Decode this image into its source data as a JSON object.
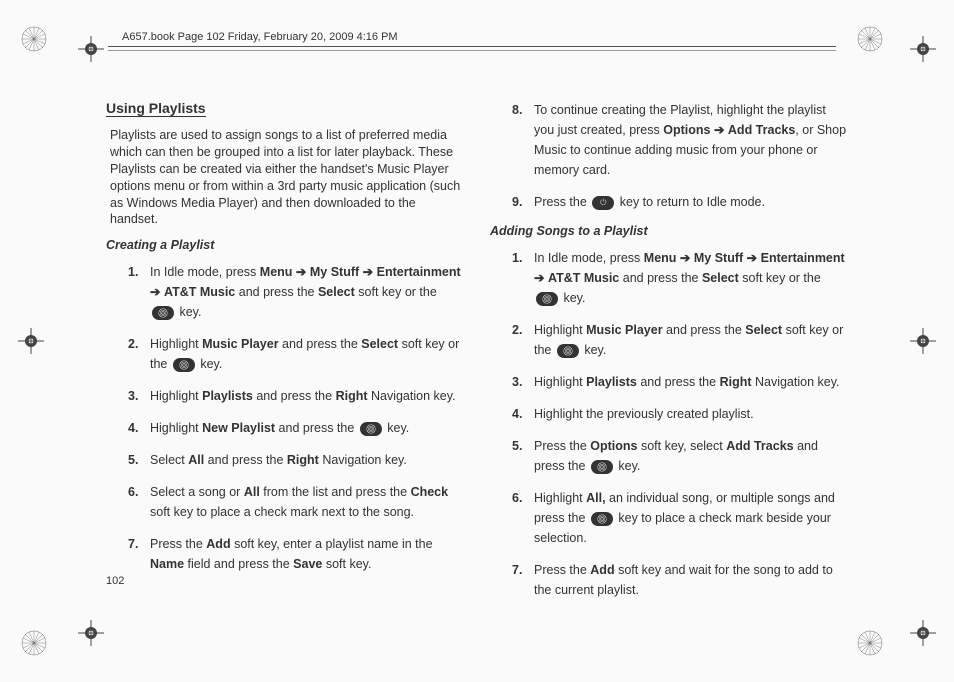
{
  "header": {
    "doc_info": "A657.book  Page 102  Friday, February 20, 2009  4:16 PM"
  },
  "page_number": "102",
  "section": {
    "title": "Using Playlists",
    "intro": "Playlists are used to assign songs to a list of preferred media which can then be grouped into a list for later playback. These Playlists can be created via either the handset's Music Player options menu or from within a 3rd party music application (such as Windows Media Player) and then downloaded to the handset."
  },
  "sub1": {
    "title": "Creating a Playlist",
    "steps": [
      {
        "n": "1.",
        "parts": [
          "In Idle mode, press ",
          {
            "b": "Menu"
          },
          " ",
          {
            "arrow": true
          },
          " ",
          {
            "b": "My Stuff"
          },
          " ",
          {
            "arrow": true
          },
          " ",
          {
            "b": "Entertainment"
          },
          " ",
          {
            "arrow": true
          },
          " ",
          {
            "b": "AT&T Music"
          },
          " and press the ",
          {
            "b": "Select"
          },
          " soft key or the ",
          {
            "icon": "circle"
          },
          " key."
        ]
      },
      {
        "n": "2.",
        "parts": [
          "Highlight ",
          {
            "b": "Music Player"
          },
          " and press the ",
          {
            "b": "Select"
          },
          " soft key or the ",
          {
            "icon": "circle"
          },
          " key."
        ]
      },
      {
        "n": "3.",
        "parts": [
          "Highlight ",
          {
            "b": "Playlists"
          },
          " and press the ",
          {
            "b": "Right"
          },
          " Navigation key."
        ]
      },
      {
        "n": "4.",
        "parts": [
          "Highlight ",
          {
            "b": "New Playlist"
          },
          " and press the ",
          {
            "icon": "circle"
          },
          " key."
        ]
      },
      {
        "n": "5.",
        "parts": [
          "Select ",
          {
            "b": "All"
          },
          " and press the ",
          {
            "b": "Right"
          },
          " Navigation key."
        ]
      },
      {
        "n": "6.",
        "parts": [
          "Select a song or ",
          {
            "b": "All"
          },
          " from the list and press the ",
          {
            "b": "Check"
          },
          " soft key to place a check mark next to the song."
        ]
      },
      {
        "n": "7.",
        "parts": [
          "Press the ",
          {
            "b": "Add"
          },
          " soft key, enter a playlist name in the ",
          {
            "b": "Name"
          },
          " field and press the ",
          {
            "b": "Save"
          },
          " soft key."
        ]
      },
      {
        "n": "8.",
        "parts": [
          "To continue creating the Playlist, highlight the playlist you just created, press ",
          {
            "b": "Options"
          },
          " ",
          {
            "arrow": true
          },
          " ",
          {
            "b": "Add Tracks"
          },
          ", or Shop Music to continue adding music from your phone or memory card."
        ]
      },
      {
        "n": "9.",
        "parts": [
          "Press the ",
          {
            "icon": "end"
          },
          " key to return to Idle mode."
        ]
      }
    ]
  },
  "sub2": {
    "title": "Adding Songs to a Playlist",
    "steps": [
      {
        "n": "1.",
        "parts": [
          "In Idle mode, press ",
          {
            "b": "Menu"
          },
          " ",
          {
            "arrow": true
          },
          " ",
          {
            "b": "My Stuff"
          },
          " ",
          {
            "arrow": true
          },
          " ",
          {
            "b": "Entertainment"
          },
          " ",
          {
            "arrow": true
          },
          " ",
          {
            "b": "AT&T Music"
          },
          " and press the ",
          {
            "b": "Select"
          },
          " soft key or the ",
          {
            "icon": "circle"
          },
          " key."
        ]
      },
      {
        "n": "2.",
        "parts": [
          "Highlight ",
          {
            "b": "Music Player"
          },
          " and press the ",
          {
            "b": "Select"
          },
          " soft key or the ",
          {
            "icon": "circle"
          },
          " key."
        ]
      },
      {
        "n": "3.",
        "parts": [
          "Highlight ",
          {
            "b": "Playlists"
          },
          " and press the ",
          {
            "b": "Right"
          },
          " Navigation key."
        ]
      },
      {
        "n": "4.",
        "parts": [
          "Highlight the previously created playlist."
        ]
      },
      {
        "n": "5.",
        "parts": [
          "Press the ",
          {
            "b": "Options"
          },
          " soft key, select ",
          {
            "b": "Add Tracks"
          },
          " and press the ",
          {
            "icon": "circle"
          },
          " key."
        ]
      },
      {
        "n": "6.",
        "parts": [
          "Highlight ",
          {
            "b": "All,"
          },
          " an individual song, or multiple songs and press the ",
          {
            "icon": "circle"
          },
          " key to place a check mark beside your selection."
        ]
      },
      {
        "n": "7.",
        "parts": [
          "Press the ",
          {
            "b": "Add"
          },
          " soft key and wait for the song to add to the current playlist."
        ]
      }
    ]
  }
}
